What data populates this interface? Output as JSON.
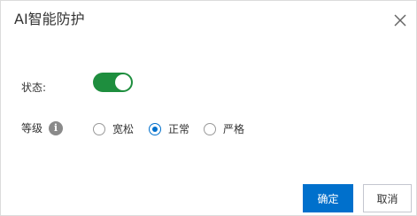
{
  "dialog": {
    "title": "AI智能防护",
    "close_icon": "close-icon"
  },
  "status": {
    "label": "状态:",
    "enabled": true
  },
  "level": {
    "label": "等级",
    "info_icon": "info-icon",
    "info_glyph": "i",
    "options": [
      {
        "label": "宽松",
        "checked": false
      },
      {
        "label": "正常",
        "checked": true
      },
      {
        "label": "严格",
        "checked": false
      }
    ]
  },
  "footer": {
    "confirm_label": "确定",
    "cancel_label": "取消"
  },
  "colors": {
    "primary": "#0070cc",
    "toggle_on": "#1e8e3e"
  }
}
